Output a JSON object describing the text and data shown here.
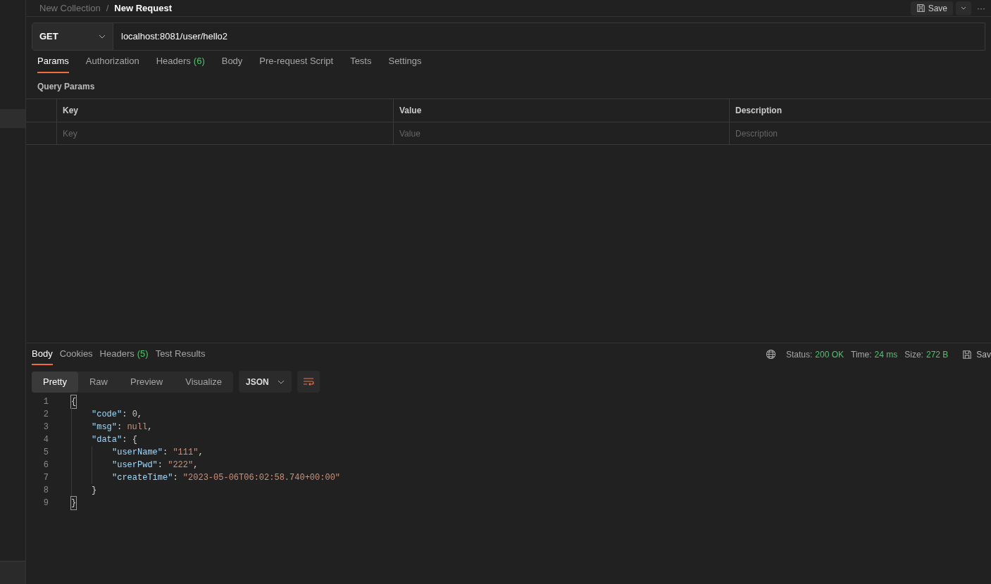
{
  "breadcrumb": {
    "collection": "New Collection",
    "separator": "/",
    "request": "New Request"
  },
  "toolbar": {
    "save": "Save",
    "more": "···"
  },
  "request": {
    "method": "GET",
    "url": "localhost:8081/user/hello2"
  },
  "request_tabs": [
    {
      "label": "Params",
      "selected": true
    },
    {
      "label": "Authorization",
      "selected": false
    },
    {
      "label": "Headers",
      "count": "(6)",
      "selected": false
    },
    {
      "label": "Body",
      "selected": false
    },
    {
      "label": "Pre-request Script",
      "selected": false
    },
    {
      "label": "Tests",
      "selected": false
    },
    {
      "label": "Settings",
      "selected": false
    }
  ],
  "query_params": {
    "title": "Query Params",
    "columns": [
      "Key",
      "Value",
      "Description"
    ],
    "placeholders": [
      "Key",
      "Value",
      "Description"
    ]
  },
  "response_tabs": [
    {
      "label": "Body",
      "selected": true
    },
    {
      "label": "Cookies",
      "selected": false
    },
    {
      "label": "Headers",
      "count": "(5)",
      "selected": false
    },
    {
      "label": "Test Results",
      "selected": false
    }
  ],
  "response_meta": [
    {
      "label": "Status:",
      "value": "200 OK"
    },
    {
      "label": "Time:",
      "value": "24 ms"
    },
    {
      "label": "Size:",
      "value": "272 B"
    }
  ],
  "save_response": "Sav",
  "view_modes": [
    {
      "label": "Pretty",
      "selected": true
    },
    {
      "label": "Raw",
      "selected": false
    },
    {
      "label": "Preview",
      "selected": false
    },
    {
      "label": "Visualize",
      "selected": false
    }
  ],
  "format": "JSON",
  "code_lines": [
    {
      "number": "1",
      "tokens": [
        {
          "kind": "brace",
          "text": "{",
          "matched": true
        }
      ]
    },
    {
      "number": "2",
      "tokens": [
        {
          "kind": "key",
          "text": "\"code\""
        },
        {
          "kind": "punct",
          "text": ": "
        },
        {
          "kind": "number",
          "text": "0"
        },
        {
          "kind": "punct",
          "text": ","
        }
      ]
    },
    {
      "number": "3",
      "tokens": [
        {
          "kind": "key",
          "text": "\"msg\""
        },
        {
          "kind": "punct",
          "text": ": "
        },
        {
          "kind": "null",
          "text": "null"
        },
        {
          "kind": "punct",
          "text": ","
        }
      ]
    },
    {
      "number": "4",
      "tokens": [
        {
          "kind": "key",
          "text": "\"data\""
        },
        {
          "kind": "punct",
          "text": ": "
        },
        {
          "kind": "brace",
          "text": "{",
          "matched": false
        }
      ]
    },
    {
      "number": "5",
      "tokens": [
        {
          "kind": "key",
          "text": "\"userName\""
        },
        {
          "kind": "punct",
          "text": ": "
        },
        {
          "kind": "string",
          "text": "\"111\""
        },
        {
          "kind": "punct",
          "text": ","
        }
      ]
    },
    {
      "number": "6",
      "tokens": [
        {
          "kind": "key",
          "text": "\"userPwd\""
        },
        {
          "kind": "punct",
          "text": ": "
        },
        {
          "kind": "string",
          "text": "\"222\""
        },
        {
          "kind": "punct",
          "text": ","
        }
      ]
    },
    {
      "number": "7",
      "tokens": [
        {
          "kind": "key",
          "text": "\"createTime\""
        },
        {
          "kind": "punct",
          "text": ": "
        },
        {
          "kind": "string",
          "text": "\"2023-05-06T06:02:58.740+00:00\""
        }
      ]
    },
    {
      "number": "8",
      "tokens": [
        {
          "kind": "brace",
          "text": "}",
          "matched": false
        }
      ]
    },
    {
      "number": "9",
      "tokens": [
        {
          "kind": "brace",
          "text": "}",
          "matched": true
        }
      ]
    }
  ]
}
